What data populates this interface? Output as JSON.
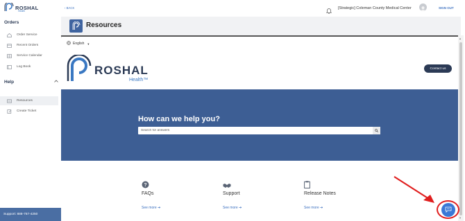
{
  "sidebar": {
    "logo": {
      "name": "ROSHAL",
      "sub": "Health"
    },
    "orders_title": "Orders",
    "order_items": [
      {
        "label": "Order Service",
        "icon": "house-icon"
      },
      {
        "label": "Recent Orders",
        "icon": "calendar-icon"
      },
      {
        "label": "Service Calendar",
        "icon": "grid-calendar-icon"
      },
      {
        "label": "Log Book",
        "icon": "book-icon"
      }
    ],
    "help_title": "Help",
    "help_items": [
      {
        "label": "Resources",
        "icon": "resources-icon",
        "active": true
      },
      {
        "label": "Create Ticket",
        "icon": "ticket-icon"
      }
    ],
    "support": "Support: 888-767-4250"
  },
  "topbar": {
    "back": "‹ BACK",
    "org": "[Strategic] Coleman County Medical Center",
    "signout": "SIGN OUT"
  },
  "page": {
    "title": "Resources"
  },
  "content": {
    "language": "English",
    "brand_name": "ROSHAL",
    "brand_health": "Health™",
    "contact": "Contact us",
    "hero_title": "How can we help you?",
    "search_placeholder": "Search for answers",
    "cards": [
      {
        "title": "FAQs",
        "link": "See more ➔",
        "icon": "question-icon"
      },
      {
        "title": "Support",
        "link": "See more ➔",
        "icon": "handshake-icon"
      },
      {
        "title": "Release Notes",
        "link": "See more ➔",
        "icon": "clipboard-icon"
      }
    ]
  },
  "colors": {
    "hero": "#3d5e94",
    "sidebar_support": "#4a6ea3",
    "accent_blue": "#3a6fbf",
    "dark_navy": "#2b3a55",
    "annotation_red": "#e01e1e"
  }
}
